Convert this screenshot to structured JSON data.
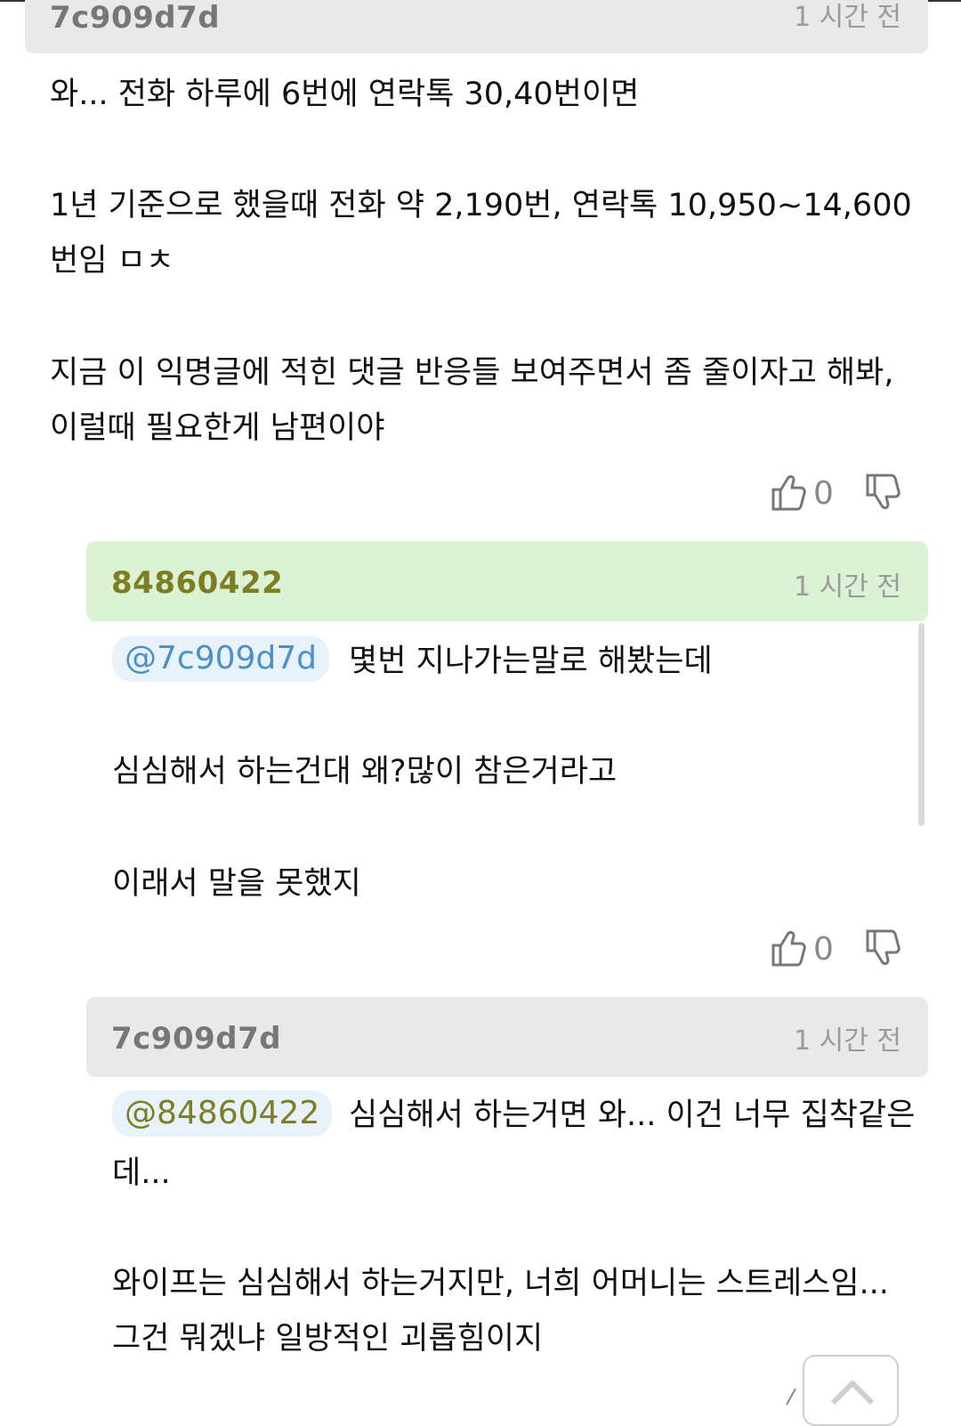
{
  "comment1": {
    "author": "7c909d7d",
    "time": "1 시간 전",
    "lines": [
      "와... 전화 하루에 6번에 연락톡 30,40번이면",
      "1년 기준으로 했을때 전화 약 2,190번, 연락톡 10,950~14,600",
      "번임 ㅁㅊ",
      "지금 이 익명글에 적힌 댓글 반응들 보여주면서 좀 줄이자고 해봐,",
      "이럴때 필요한게 남편이야"
    ],
    "likes": "0"
  },
  "reply1": {
    "author": "84860422",
    "time": "1 시간 전",
    "mention": "@7c909d7d",
    "lines": [
      "몇번 지나가는말로 해봤는데",
      "심심해서 하는건대 왜?많이 참은거라고",
      "이래서 말을 못했지"
    ],
    "likes": "0"
  },
  "reply2": {
    "author": "7c909d7d",
    "time": "1 시간 전",
    "mention": "@84860422",
    "lines": [
      "심심해서 하는거면 와... 이건 너무 집착같은",
      "데...",
      "와이프는 심심해서 하는거지만, 너희 어머니는 스트레스임...",
      "그건 뭐겠냐 일방적인 괴롭힘이지"
    ]
  },
  "icons": {
    "like": "thumbs-up-icon",
    "dislike": "thumbs-down-icon",
    "scroll_top": "scroll-to-top-icon"
  },
  "colors": {
    "header_gray": "#e9e9e9",
    "header_green": "#dcf2d5",
    "mention_bg": "#e8f2fb",
    "mention_blue": "#4b90c8",
    "author_olive": "#7d7d22"
  }
}
